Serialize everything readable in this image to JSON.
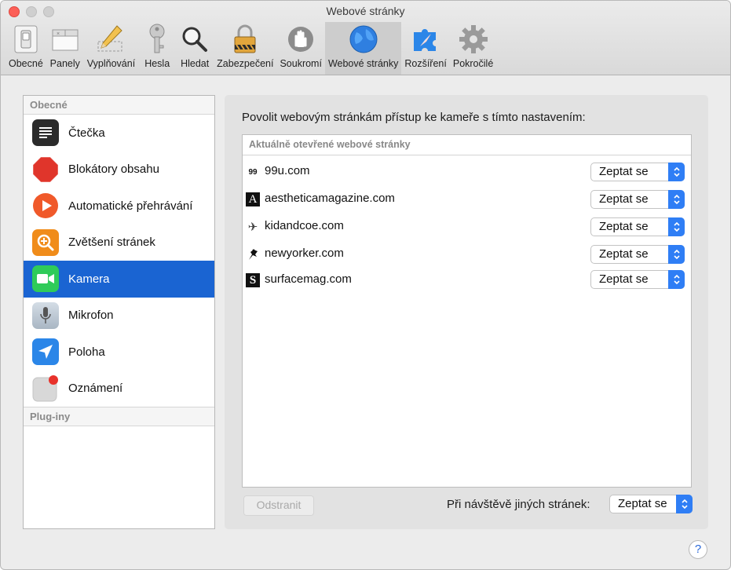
{
  "window": {
    "title": "Webové stránky"
  },
  "toolbar": {
    "items": [
      {
        "label": "Obecné",
        "icon": "switch-icon"
      },
      {
        "label": "Panely",
        "icon": "tabs-icon"
      },
      {
        "label": "Vyplňování",
        "icon": "pencil-icon"
      },
      {
        "label": "Hesla",
        "icon": "key-icon"
      },
      {
        "label": "Hledat",
        "icon": "magnifier-icon"
      },
      {
        "label": "Zabezpečení",
        "icon": "padlock-icon"
      },
      {
        "label": "Soukromí",
        "icon": "hand-icon"
      },
      {
        "label": "Webové stránky",
        "icon": "globe-icon"
      },
      {
        "label": "Rozšíření",
        "icon": "puzzle-icon"
      },
      {
        "label": "Pokročilé",
        "icon": "gear-icon"
      }
    ],
    "active_index": 7
  },
  "sidebar": {
    "section_general": "Obecné",
    "items": [
      {
        "label": "Čtečka",
        "icon": "reader-icon",
        "color": "#2b2b2b"
      },
      {
        "label": "Blokátory obsahu",
        "icon": "stop-sign-icon",
        "color": "#e0352b"
      },
      {
        "label": "Automatické přehrávání",
        "icon": "play-icon",
        "color": "#f0592a"
      },
      {
        "label": "Zvětšení stránek",
        "icon": "zoom-icon",
        "color": "#f08c1a"
      },
      {
        "label": "Kamera",
        "icon": "camera-icon",
        "color": "#2fcb59"
      },
      {
        "label": "Mikrofon",
        "icon": "microphone-icon",
        "color": "#b9c6d2"
      },
      {
        "label": "Poloha",
        "icon": "location-arrow-icon",
        "color": "#2b86e8"
      },
      {
        "label": "Oznámení",
        "icon": "notification-icon",
        "color": "#d8d8d8"
      }
    ],
    "selected_index": 4,
    "section_plugins": "Plug-iny"
  },
  "main": {
    "heading": "Povolit webovým stránkám přístup ke kameře s tímto nastavením:",
    "list_header": "Aktuálně otevřené webové stránky",
    "sites": [
      {
        "name": "99u.com",
        "favicon_text": "99",
        "setting": "Zeptat se"
      },
      {
        "name": "aestheticamagazine.com",
        "favicon_text": "A",
        "setting": "Zeptat se"
      },
      {
        "name": "kidandcoe.com",
        "favicon_text": "✈",
        "setting": "Zeptat se"
      },
      {
        "name": "newyorker.com",
        "favicon_text": "",
        "setting": "Zeptat se"
      },
      {
        "name": "surfacemag.com",
        "favicon_text": "S",
        "setting": "Zeptat se"
      }
    ],
    "remove_label": "Odstranit",
    "other_sites_label": "Při návštěvě jiných stránek:",
    "other_sites_value": "Zeptat se"
  },
  "help": {
    "label": "?"
  },
  "colors": {
    "accent": "#1a64d2",
    "popup_button": "#2f7ef5"
  }
}
